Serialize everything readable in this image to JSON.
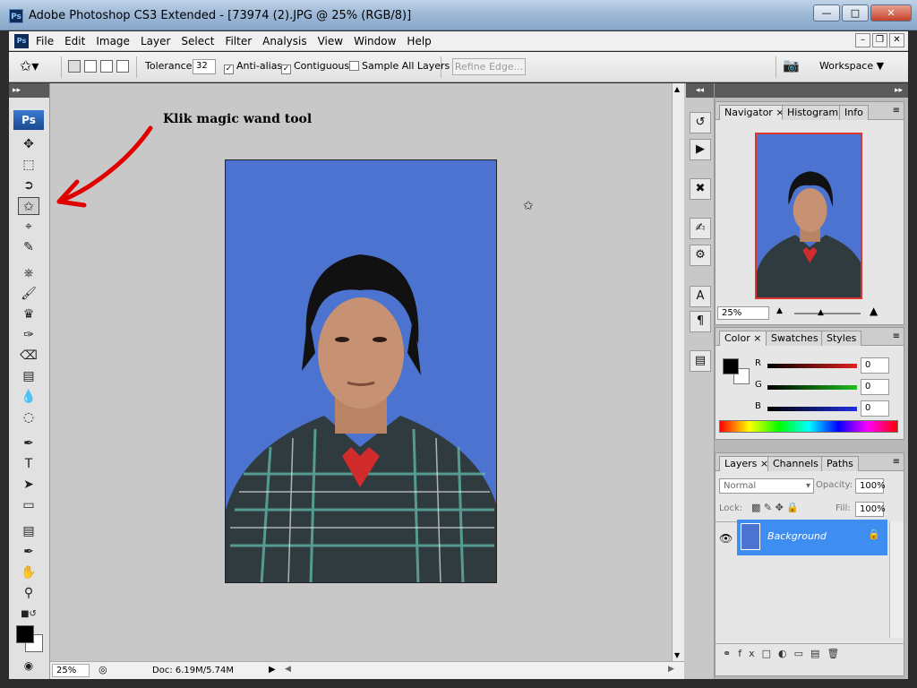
{
  "window": {
    "title": "Adobe Photoshop CS3 Extended - [73974 (2).JPG @ 25% (RGB/8)]",
    "app_icon": "Ps",
    "controls": [
      "minimize",
      "maximize",
      "close"
    ]
  },
  "menu": {
    "items": [
      "File",
      "Edit",
      "Image",
      "Layer",
      "Select",
      "Filter",
      "Analysis",
      "View",
      "Window",
      "Help"
    ]
  },
  "options_bar": {
    "tolerance_label": "Tolerance:",
    "tolerance_value": "32",
    "anti_alias_label": "Anti-alias",
    "anti_alias_checked": true,
    "contiguous_label": "Contiguous",
    "contiguous_checked": true,
    "sample_all_label": "Sample All Layers",
    "sample_all_checked": false,
    "refine_edge_label": "Refine Edge...",
    "workspace_label": "Workspace"
  },
  "toolbox": {
    "logo": "Ps",
    "active_tool": "magic-wand",
    "tools": [
      "move",
      "marquee",
      "lasso",
      "magic-wand",
      "crop",
      "slice",
      "healing",
      "brush",
      "clone-stamp",
      "history-brush",
      "eraser",
      "gradient",
      "blur",
      "dodge",
      "pen",
      "type",
      "path-selection",
      "shape",
      "notes",
      "eyedropper",
      "hand",
      "zoom"
    ]
  },
  "annotation": {
    "text": "Klik magic wand tool",
    "arrow_color": "#e00000"
  },
  "status_bar": {
    "zoom": "25%",
    "doc_info": "Doc: 6.19M/5.74M"
  },
  "navigator_panel": {
    "tabs": [
      "Navigator",
      "Histogram",
      "Info"
    ],
    "active_tab": "Navigator",
    "zoom": "25%"
  },
  "color_panel": {
    "tabs": [
      "Color",
      "Swatches",
      "Styles"
    ],
    "active_tab": "Color",
    "channels": [
      {
        "label": "R",
        "value": "0",
        "color": "#e02020"
      },
      {
        "label": "G",
        "value": "0",
        "color": "#20c020"
      },
      {
        "label": "B",
        "value": "0",
        "color": "#2030e0"
      }
    ]
  },
  "layers_panel": {
    "tabs": [
      "Layers",
      "Channels",
      "Paths"
    ],
    "active_tab": "Layers",
    "blend_mode": "Normal",
    "opacity_label": "Opacity:",
    "opacity_value": "100%",
    "lock_label": "Lock:",
    "fill_label": "Fill:",
    "fill_value": "100%",
    "layers": [
      {
        "name": "Background",
        "locked": true,
        "visible": true
      }
    ]
  },
  "colors": {
    "accent_selection": "#3d8ef0",
    "photo_background": "#4b73cf",
    "workspace_gray": "#c8c8c8"
  }
}
